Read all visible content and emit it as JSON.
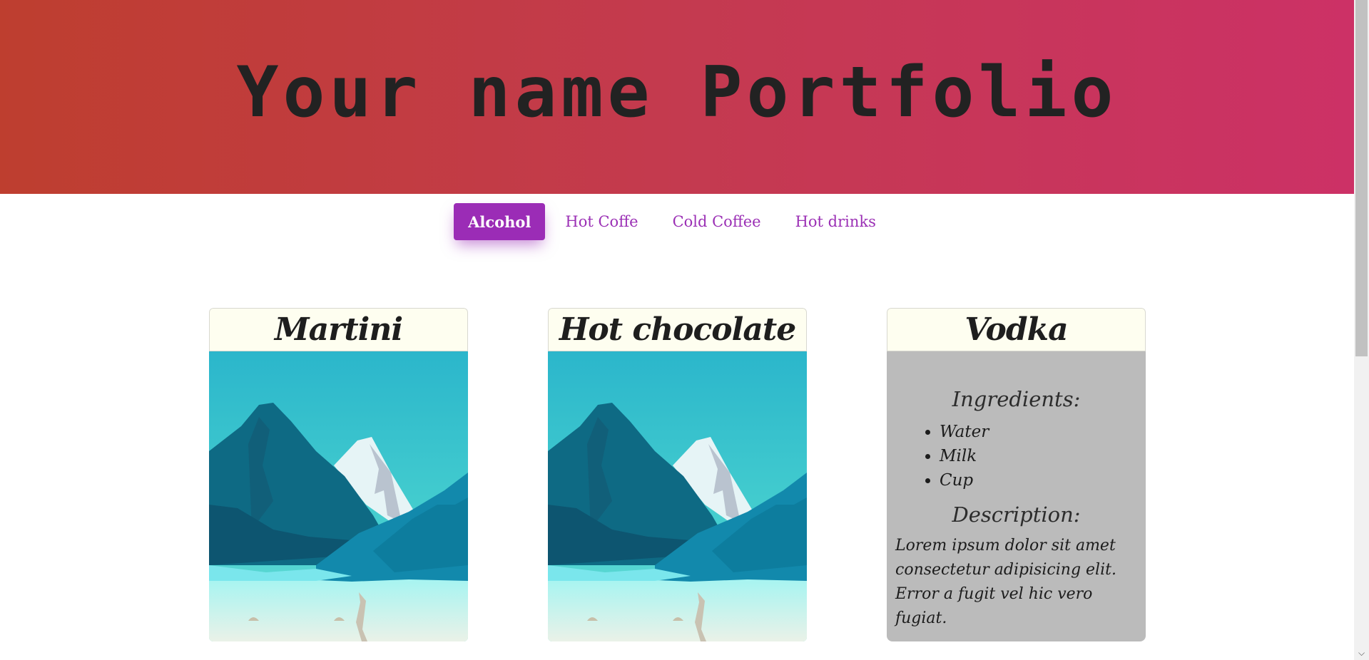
{
  "header": {
    "title": "Your name Portfolio"
  },
  "tabs": [
    {
      "label": "Alcohol",
      "active": true
    },
    {
      "label": "Hot Coffe",
      "active": false
    },
    {
      "label": "Cold Coffee",
      "active": false
    },
    {
      "label": "Hot drinks",
      "active": false
    }
  ],
  "cards": [
    {
      "title": "Martini",
      "view": "image"
    },
    {
      "title": "Hot chocolate",
      "view": "image"
    },
    {
      "title": "Vodka",
      "view": "details",
      "ingredients_heading": "Ingredients:",
      "ingredients": [
        "Water",
        "Milk",
        "Cup"
      ],
      "description_heading": "Description:",
      "description": "Lorem ipsum dolor sit amet consectetur adipisicing elit. Error a fugit vel hic vero fugiat."
    }
  ],
  "colors": {
    "header_gradient_start": "#be3e2f",
    "header_gradient_end": "#cc3166",
    "accent": "#9b2cb6",
    "card_head_bg": "#fefef0",
    "card_details_bg": "#bbbbbb"
  },
  "icons": {
    "scroll_down": "chevron-down-icon"
  }
}
